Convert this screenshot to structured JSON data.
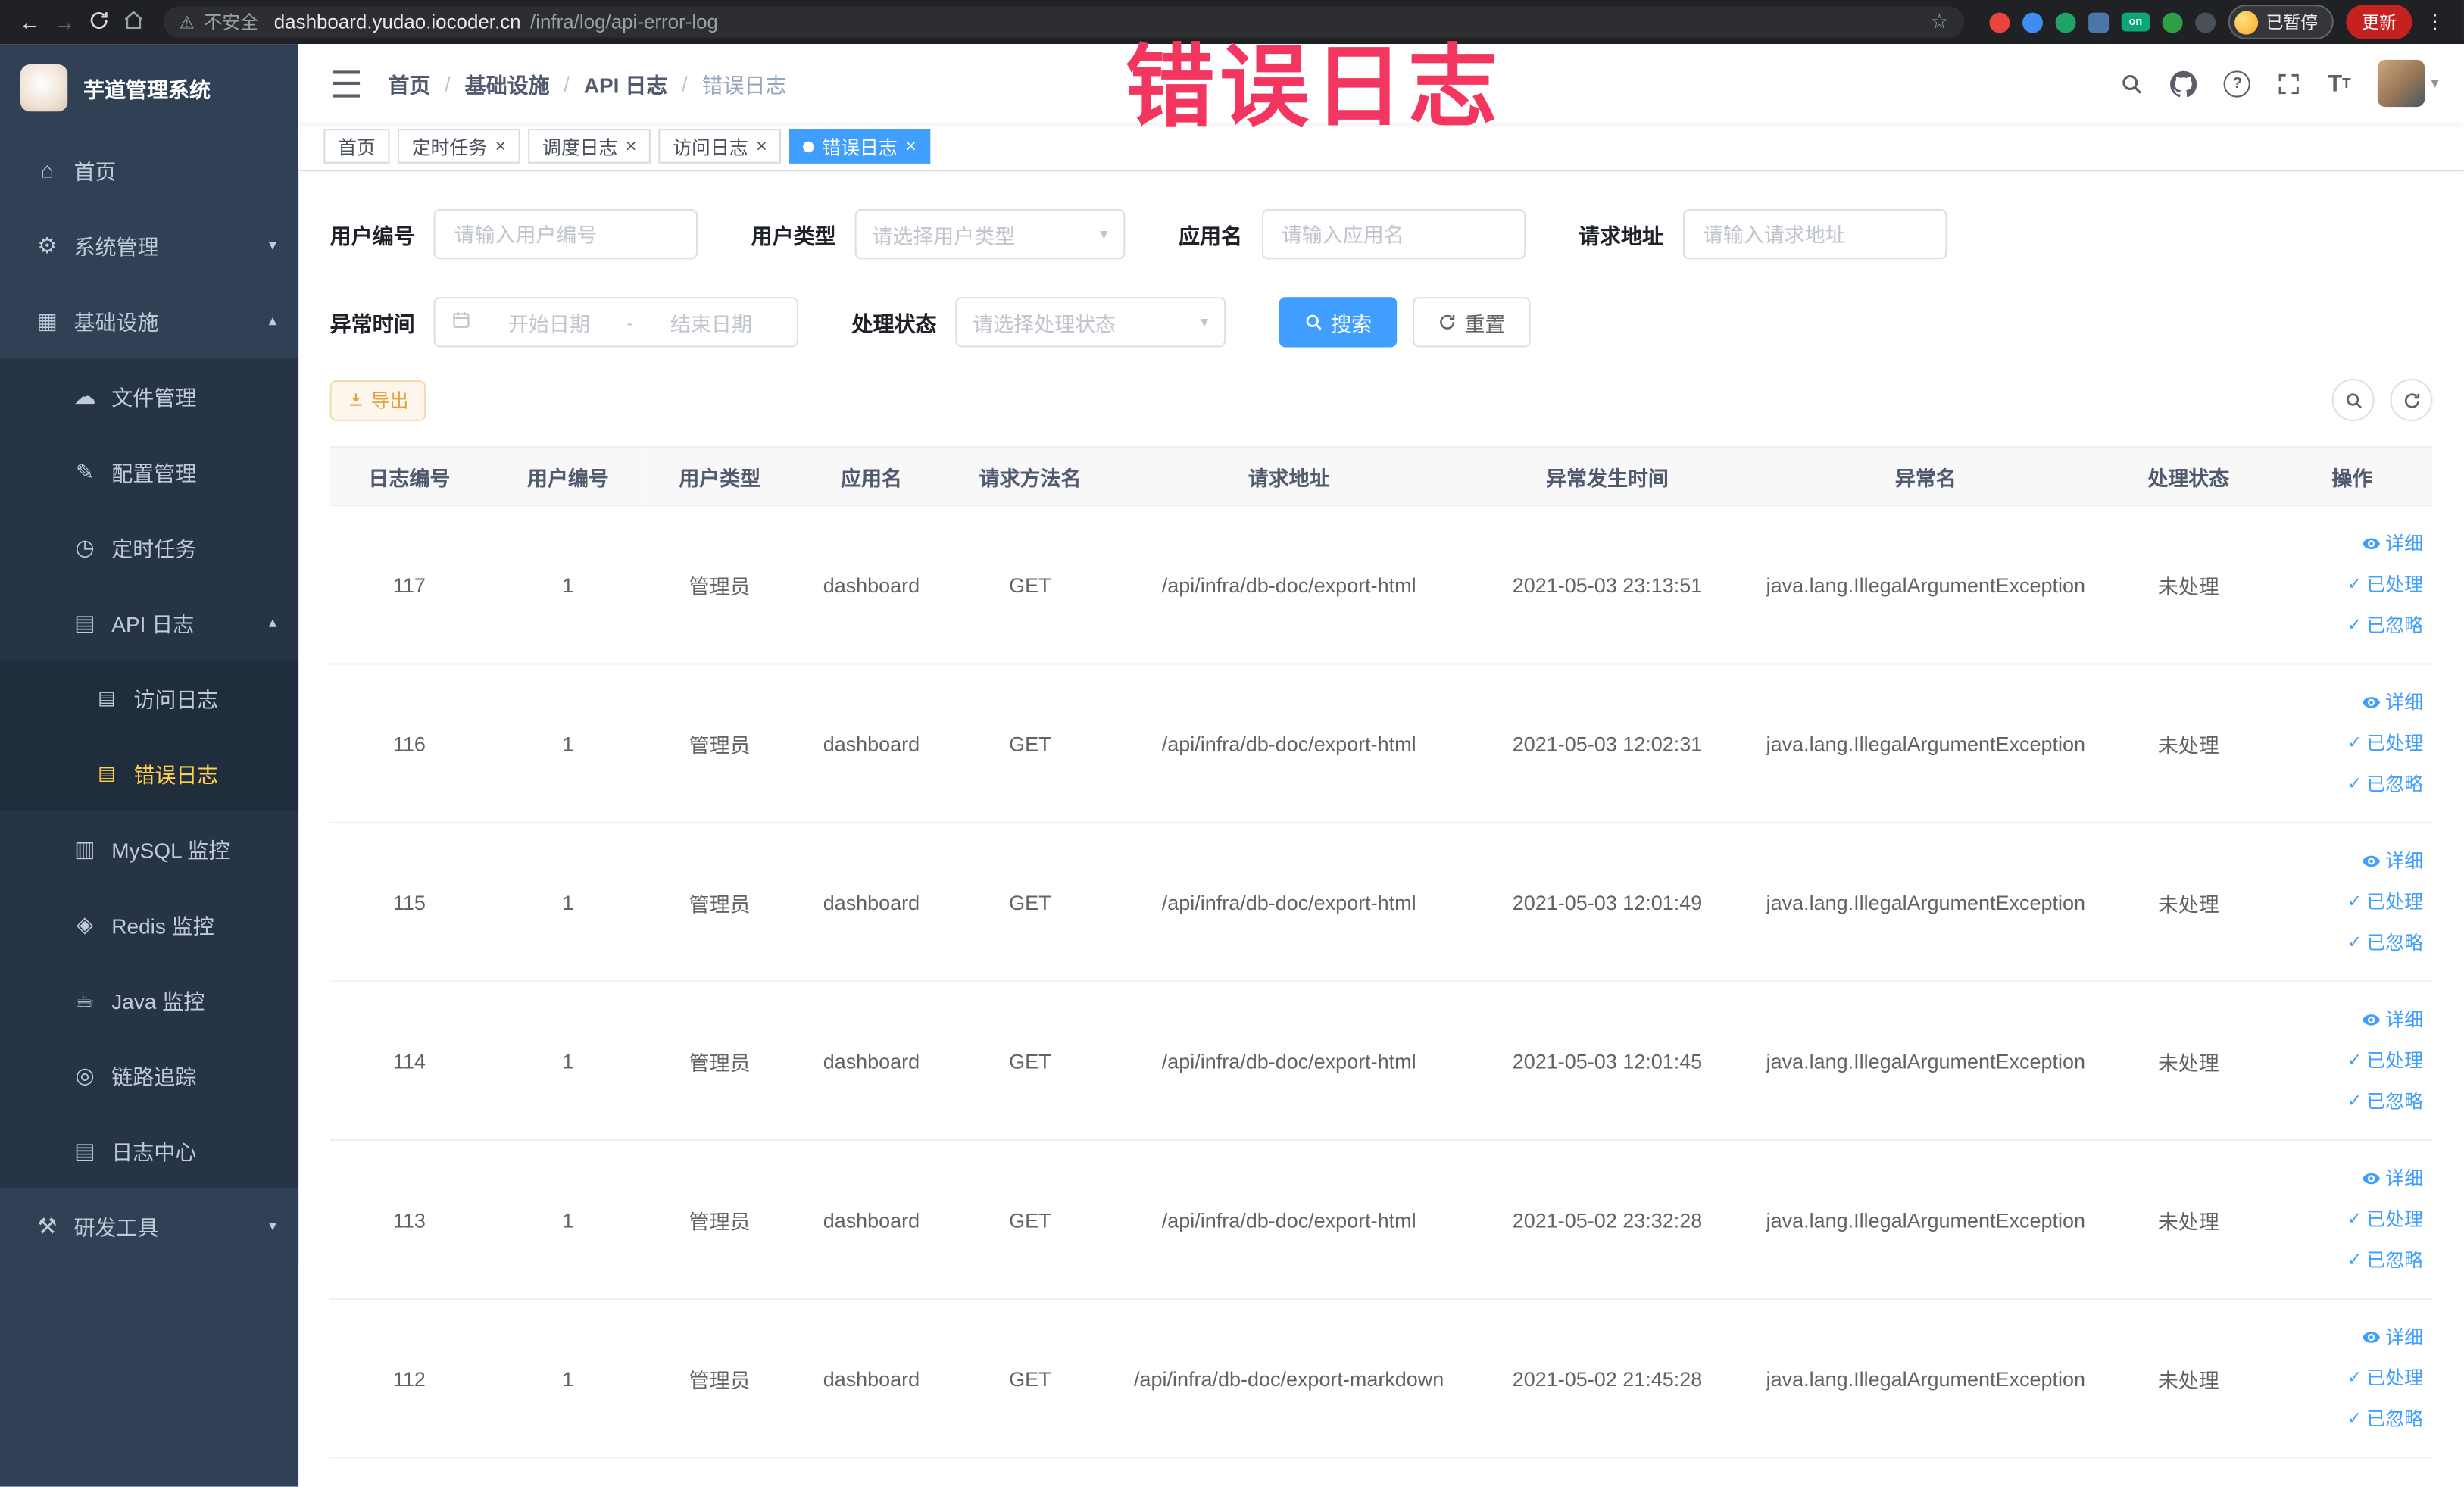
{
  "browser": {
    "security_label": "不安全",
    "url_host": "dashboard.yudao.iocoder.cn",
    "url_path": "/infra/log/api-error-log",
    "profile_badge": "已暂停",
    "update_label": "更新",
    "extensions": [
      {
        "name": "extension-red-circle-icon",
        "color": "#e8453c",
        "shape": "circle"
      },
      {
        "name": "extension-blue-drop-icon",
        "color": "#3d8ef0",
        "shape": "circle"
      },
      {
        "name": "extension-green-circle-icon",
        "color": "#21a366",
        "shape": "circle"
      },
      {
        "name": "extension-blue-grid-icon",
        "color": "#4a76a8",
        "shape": "square"
      },
      {
        "name": "extension-on-badge-icon",
        "color": "#0ca678",
        "shape": "badge",
        "label": "on"
      },
      {
        "name": "extension-green-leaf-icon",
        "color": "#2f9e44",
        "shape": "circle"
      },
      {
        "name": "extension-dark-plug-icon",
        "color": "#495057",
        "shape": "circle"
      }
    ]
  },
  "overlay": {
    "text": "错误日志",
    "color": "#f2365f"
  },
  "sidebar": {
    "logo_title": "芋道管理系统",
    "items": [
      {
        "label": "首页",
        "icon": "sidebar-home-icon",
        "level": 1
      },
      {
        "label": "系统管理",
        "icon": "gear-icon",
        "level": 1,
        "expand": "down"
      },
      {
        "label": "基础设施",
        "icon": "infra-icon",
        "level": 1,
        "expand": "up"
      },
      {
        "label": "文件管理",
        "icon": "file-icon",
        "level": 2
      },
      {
        "label": "配置管理",
        "icon": "config-icon",
        "level": 2
      },
      {
        "label": "定时任务",
        "icon": "timer-icon",
        "level": 2
      },
      {
        "label": "API 日志",
        "icon": "api-log-icon",
        "level": 2,
        "expand": "up"
      },
      {
        "label": "访问日志",
        "icon": "doc-icon",
        "level": 3
      },
      {
        "label": "错误日志",
        "icon": "doc-icon",
        "level": 3,
        "active": true
      },
      {
        "label": "MySQL 监控",
        "icon": "mysql-icon",
        "level": 2
      },
      {
        "label": "Redis 监控",
        "icon": "redis-icon",
        "level": 2
      },
      {
        "label": "Java 监控",
        "icon": "java-icon",
        "level": 2
      },
      {
        "label": "链路追踪",
        "icon": "trace-icon",
        "level": 2
      },
      {
        "label": "日志中心",
        "icon": "log-center-icon",
        "level": 2
      },
      {
        "label": "研发工具",
        "icon": "tools-icon",
        "level": 1,
        "expand": "down"
      }
    ]
  },
  "header": {
    "breadcrumb": [
      "首页",
      "基础设施",
      "API 日志",
      "错误日志"
    ]
  },
  "tabs": [
    {
      "label": "首页",
      "closable": false,
      "active": false
    },
    {
      "label": "定时任务",
      "closable": true,
      "active": false
    },
    {
      "label": "调度日志",
      "closable": true,
      "active": false
    },
    {
      "label": "访问日志",
      "closable": true,
      "active": false
    },
    {
      "label": "错误日志",
      "closable": true,
      "active": true
    }
  ],
  "filters": {
    "fields": [
      {
        "name": "user-id",
        "label": "用户编号",
        "type": "input",
        "placeholder": "请输入用户编号"
      },
      {
        "name": "user-type",
        "label": "用户类型",
        "type": "select",
        "placeholder": "请选择用户类型"
      },
      {
        "name": "app-name",
        "label": "应用名",
        "type": "input",
        "placeholder": "请输入应用名"
      },
      {
        "name": "request-url",
        "label": "请求地址",
        "type": "input",
        "placeholder": "请输入请求地址"
      },
      {
        "name": "exception-time",
        "label": "异常时间",
        "type": "daterange",
        "start_placeholder": "开始日期",
        "separator": "-",
        "end_placeholder": "结束日期"
      },
      {
        "name": "process-status",
        "label": "处理状态",
        "type": "select",
        "placeholder": "请选择处理状态"
      }
    ],
    "search_label": "搜索",
    "reset_label": "重置"
  },
  "toolbar": {
    "export_label": "导出"
  },
  "table": {
    "columns": [
      "日志编号",
      "用户编号",
      "用户类型",
      "应用名",
      "请求方法名",
      "请求地址",
      "异常发生时间",
      "异常名",
      "处理状态",
      "操作"
    ],
    "action_labels": [
      "详细",
      "已处理",
      "已忽略"
    ],
    "rows": [
      {
        "id": "117",
        "user_id": "1",
        "user_type": "管理员",
        "app_name": "dashboard",
        "method": "GET",
        "url": "/api/infra/db-doc/export-html",
        "time": "2021-05-03 23:13:51",
        "exception": "java.lang.IllegalArgumentException",
        "status": "未处理"
      },
      {
        "id": "116",
        "user_id": "1",
        "user_type": "管理员",
        "app_name": "dashboard",
        "method": "GET",
        "url": "/api/infra/db-doc/export-html",
        "time": "2021-05-03 12:02:31",
        "exception": "java.lang.IllegalArgumentException",
        "status": "未处理"
      },
      {
        "id": "115",
        "user_id": "1",
        "user_type": "管理员",
        "app_name": "dashboard",
        "method": "GET",
        "url": "/api/infra/db-doc/export-html",
        "time": "2021-05-03 12:01:49",
        "exception": "java.lang.IllegalArgumentException",
        "status": "未处理"
      },
      {
        "id": "114",
        "user_id": "1",
        "user_type": "管理员",
        "app_name": "dashboard",
        "method": "GET",
        "url": "/api/infra/db-doc/export-html",
        "time": "2021-05-03 12:01:45",
        "exception": "java.lang.IllegalArgumentException",
        "status": "未处理"
      },
      {
        "id": "113",
        "user_id": "1",
        "user_type": "管理员",
        "app_name": "dashboard",
        "method": "GET",
        "url": "/api/infra/db-doc/export-html",
        "time": "2021-05-02 23:32:28",
        "exception": "java.lang.IllegalArgumentException",
        "status": "未处理"
      },
      {
        "id": "112",
        "user_id": "1",
        "user_type": "管理员",
        "app_name": "dashboard",
        "method": "GET",
        "url": "/api/infra/db-doc/export-markdown",
        "time": "2021-05-02 21:45:28",
        "exception": "java.lang.IllegalArgumentException",
        "status": "未处理"
      }
    ]
  },
  "icons": {
    "back-icon": "←",
    "forward-icon": "→",
    "warning-icon": "⚠",
    "star-icon": "☆",
    "menu-dots-icon": "⋮",
    "caret-down-icon": "▾",
    "chevron-up-icon": "▴",
    "chevron-down-icon": "▾",
    "sidebar-home-icon": "⌂",
    "gear-icon": "⚙",
    "infra-icon": "▦",
    "file-icon": "☁",
    "config-icon": "✎",
    "timer-icon": "◷",
    "api-log-icon": "▤",
    "doc-icon": "▤",
    "mysql-icon": "▥",
    "redis-icon": "◈",
    "java-icon": "☕",
    "trace-icon": "◎",
    "log-center-icon": "▤",
    "tools-icon": "⚒",
    "close-icon": "×",
    "check-icon": "✓"
  }
}
